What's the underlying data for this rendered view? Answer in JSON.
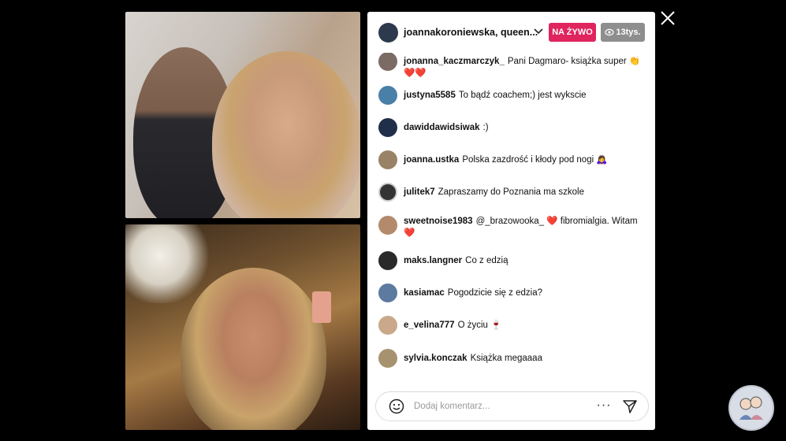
{
  "stream": {
    "header": {
      "title": "joannakoroniewska, queen...",
      "live_badge": "NA ŻYWO",
      "viewer_count": "13tys."
    },
    "comments": [
      {
        "user": "jonanna_kaczmarczyk_",
        "text": "Pani Dagmaro- książka super 👏 ❤️❤️"
      },
      {
        "user": "justyna5585",
        "text": "To bądź coachem;) jest wykscie"
      },
      {
        "user": "dawiddawidsiwak",
        "text": ":)"
      },
      {
        "user": "joanna.ustka",
        "text": "Polska zazdrość i kłody pod nogi 🙇‍♀️"
      },
      {
        "user": "julitek7",
        "text": "Zapraszamy do Poznania ma szkole"
      },
      {
        "user": "sweetnoise1983",
        "text": "@_brazowooka_ ❤️ fibromialgia. Witam ❤️"
      },
      {
        "user": "maks.langner",
        "text": "Co z edzią"
      },
      {
        "user": "kasiamac",
        "text": "Pogodzicie się z edzia?"
      },
      {
        "user": "e_velina777",
        "text": "O życiu 🍷"
      },
      {
        "user": "sylvia.konczak",
        "text": "Książka megaaaa"
      }
    ],
    "comment_bar": {
      "placeholder": "Dodaj komentarz...",
      "more_label": "···"
    }
  },
  "colors": {
    "live_badge": "#e0245e",
    "viewer_badge": "#8e8e8e",
    "background": "#000000",
    "panel": "#ffffff"
  },
  "icons": {
    "close": "close-icon",
    "chevron": "chevron-down-icon",
    "eye": "eye-icon",
    "emoji": "smiley-icon",
    "send": "send-icon"
  }
}
